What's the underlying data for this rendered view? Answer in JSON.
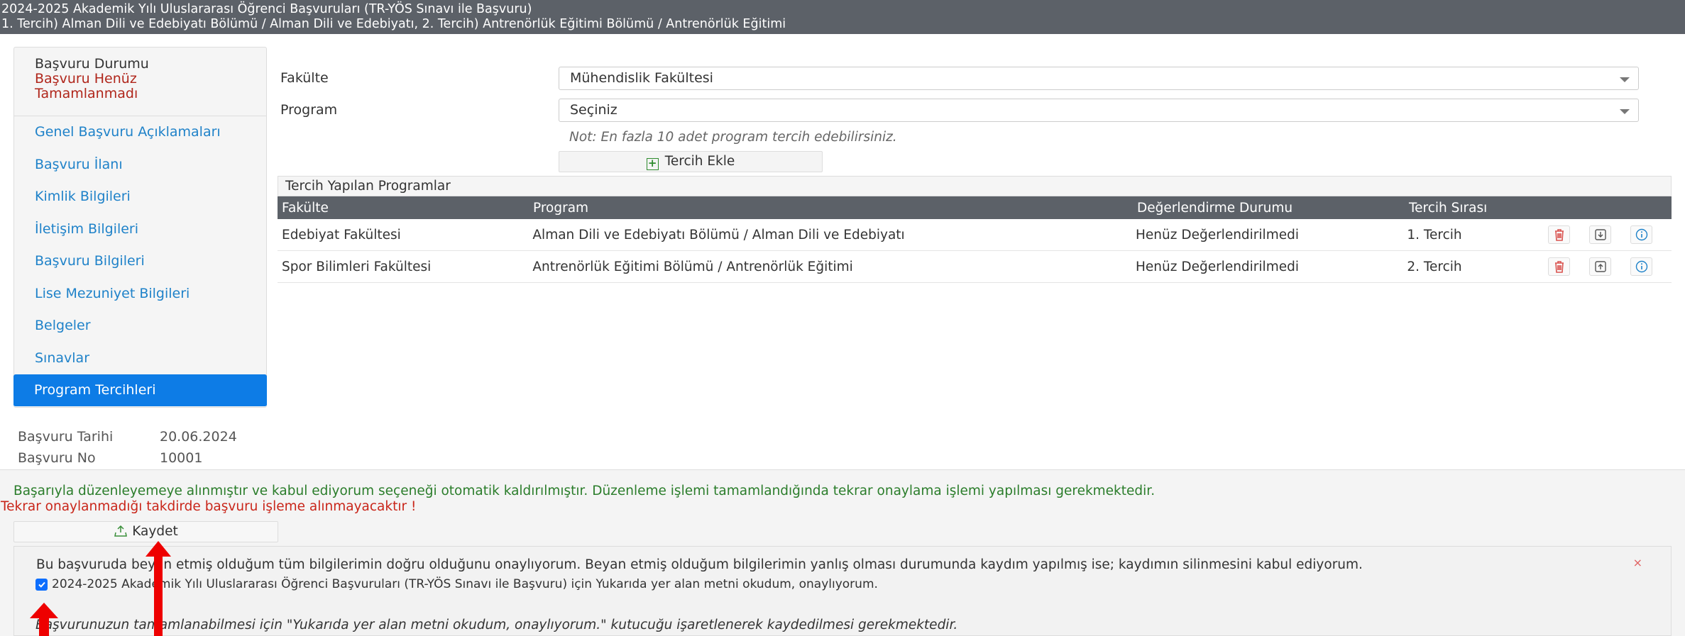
{
  "header": {
    "title_line1": "2024-2025 Akademik Yılı Uluslararası Öğrenci Başvuruları (TR-YÖS Sınavı ile Başvuru)",
    "title_line2": "1. Tercih) Alman Dili ve Edebiyatı Bölümü / Alman Dili ve Edebiyatı, 2. Tercih) Antrenörlük Eğitimi Bölümü / Antrenörlük Eğitimi"
  },
  "sidebar": {
    "status_label": "Başvuru Durumu",
    "status_value_line1": "Başvuru Henüz",
    "status_value_line2": "Tamamlanmadı",
    "items": [
      {
        "label": "Genel Başvuru Açıklamaları"
      },
      {
        "label": "Başvuru İlanı"
      },
      {
        "label": "Kimlik Bilgileri"
      },
      {
        "label": "İletişim Bilgileri"
      },
      {
        "label": "Başvuru Bilgileri"
      },
      {
        "label": "Lise Mezuniyet Bilgileri"
      },
      {
        "label": "Belgeler"
      },
      {
        "label": "Sınavlar"
      },
      {
        "label": "Program Tercihleri"
      }
    ],
    "active_item": "Program Tercihleri"
  },
  "app_info": {
    "date_label": "Başvuru Tarihi",
    "date_value": "20.06.2024",
    "no_label": "Başvuru No",
    "no_value": "10001"
  },
  "form": {
    "faculty_label": "Fakülte",
    "faculty_value": "Mühendislik Fakültesi",
    "program_label": "Program",
    "program_value": "Seçiniz",
    "note": "Not: En fazla 10 adet program tercih edebilirsiniz.",
    "add_button": "Tercih Ekle"
  },
  "preferences": {
    "panel_title": "Tercih Yapılan Programlar",
    "columns": [
      "Fakülte",
      "Program",
      "Değerlendirme Durumu",
      "Tercih Sırası"
    ],
    "rows": [
      {
        "faculty": "Edebiyat Fakültesi",
        "program": "Alman Dili ve Edebiyatı Bölümü / Alman Dili ve Edebiyatı",
        "status": "Henüz Değerlendirilmedi",
        "order": "1. Tercih"
      },
      {
        "faculty": "Spor Bilimleri Fakültesi",
        "program": "Antrenörlük Eğitimi Bölümü / Antrenörlük Eğitimi",
        "status": "Henüz Değerlendirilmedi",
        "order": "2. Tercih"
      }
    ]
  },
  "messages": {
    "success": "Başarıyla düzenleyemeye alınmıştır ve kabul ediyorum seçeneği otomatik kaldırılmıştır. Düzenleme işlemi tamamlandığında tekrar onaylama işlemi yapılması gerekmektedir.",
    "warning": "Tekrar onaylanmadığı takdirde başvuru işleme alınmayacaktır !",
    "save_button": "Kaydet"
  },
  "consent": {
    "text": "Bu başvuruda beyan etmiş olduğum tüm bilgilerimin doğru olduğunu onaylıyorum. Beyan etmiş olduğum bilgilerimin yanlış olması durumunda kaydım yapılmış ise; kaydımın silinmesini kabul ediyorum.",
    "checkbox_label": "2024-2025 Akademik Yılı Uluslararası Öğrenci Başvuruları (TR-YÖS Sınavı ile Başvuru) için Yukarıda yer alan metni okudum, onaylıyorum.",
    "checked": true,
    "close": "×",
    "warning": "Başvurunuzun tamamlanabilmesi için \"Yukarıda yer alan metni okudum, onaylıyorum.\" kutucuğu işaretlenerek kaydedilmesi gerekmektedir."
  },
  "colors": {
    "header_bg": "#5c6168",
    "active": "#0d7ce6",
    "link": "#1f82c9",
    "success": "#2b7d2b",
    "danger": "#c9261a",
    "annotation_arrow": "#ee0000"
  }
}
